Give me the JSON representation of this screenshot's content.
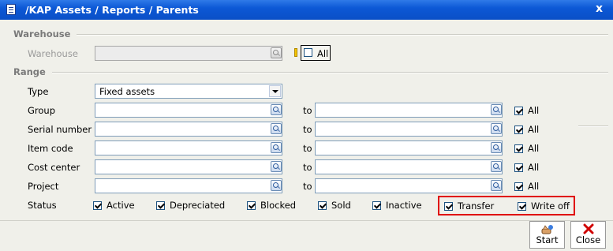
{
  "window": {
    "title": "/KAP  Assets / Reports / Parents",
    "close_glyph": "x"
  },
  "warehouse": {
    "section": "Warehouse",
    "label": "Warehouse",
    "value": "",
    "all_label": "All"
  },
  "range": {
    "section": "Range",
    "type_label": "Type",
    "type_value": "Fixed assets",
    "to_label": "to",
    "all_label": "All",
    "rows": [
      {
        "label": "Group"
      },
      {
        "label": "Serial number"
      },
      {
        "label": "Item code"
      },
      {
        "label": "Cost center"
      },
      {
        "label": "Project"
      }
    ],
    "status_label": "Status",
    "status": [
      "Active",
      "Depreciated",
      "Blocked",
      "Sold",
      "Inactive",
      "Transfer",
      "Write off"
    ]
  },
  "buttons": {
    "start": "Start",
    "close": "Close"
  },
  "colors": {
    "title_bar": "#0c58d6",
    "highlight": "#e00000"
  }
}
